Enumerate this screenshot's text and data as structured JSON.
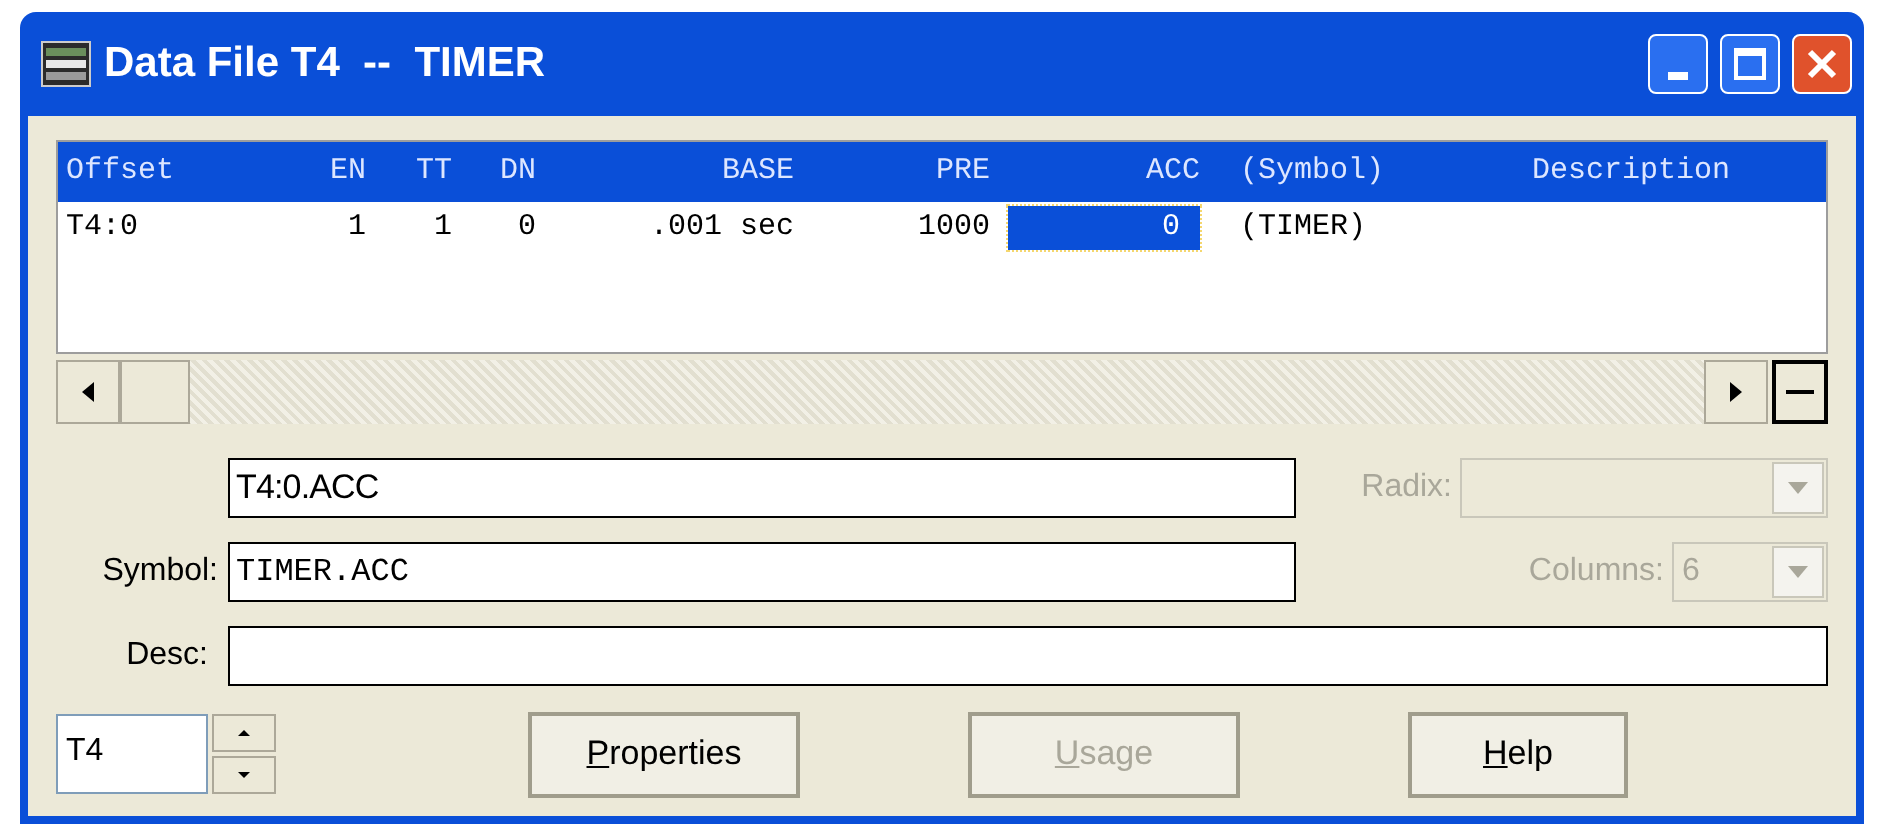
{
  "window": {
    "title": "Data File T4  --  TIMER"
  },
  "table": {
    "columns": [
      {
        "label": "Offset"
      },
      {
        "label": "EN"
      },
      {
        "label": "TT"
      },
      {
        "label": "DN"
      },
      {
        "label": "BASE"
      },
      {
        "label": "PRE"
      },
      {
        "label": "ACC"
      },
      {
        "label": "(Symbol)"
      },
      {
        "label": "Description"
      }
    ],
    "rows": [
      {
        "cells": [
          {
            "text": "T4:0",
            "selected": false
          },
          {
            "text": "1",
            "selected": false
          },
          {
            "text": "1",
            "selected": false
          },
          {
            "text": "0",
            "selected": false
          },
          {
            "text": ".001 sec",
            "selected": false
          },
          {
            "text": "1000",
            "selected": false
          },
          {
            "text": "0",
            "selected": true
          },
          {
            "text": "(TIMER)",
            "selected": false
          }
        ]
      }
    ]
  },
  "address_field": {
    "value": "T4:0.ACC"
  },
  "radix": {
    "label": "Radix:",
    "disabled": true
  },
  "symbol": {
    "label": "Symbol:",
    "value": "TIMER.ACC"
  },
  "columns_select": {
    "label": "Columns:",
    "value": "6",
    "disabled": true
  },
  "desc": {
    "label": "Desc:"
  },
  "file_spinner": {
    "value": "T4"
  },
  "buttons": [
    {
      "accel": "P",
      "rest": "roperties",
      "disabled": false
    },
    {
      "accel": "U",
      "rest": "sage",
      "disabled": true
    },
    {
      "accel": "H",
      "rest": "elp",
      "disabled": false
    }
  ]
}
